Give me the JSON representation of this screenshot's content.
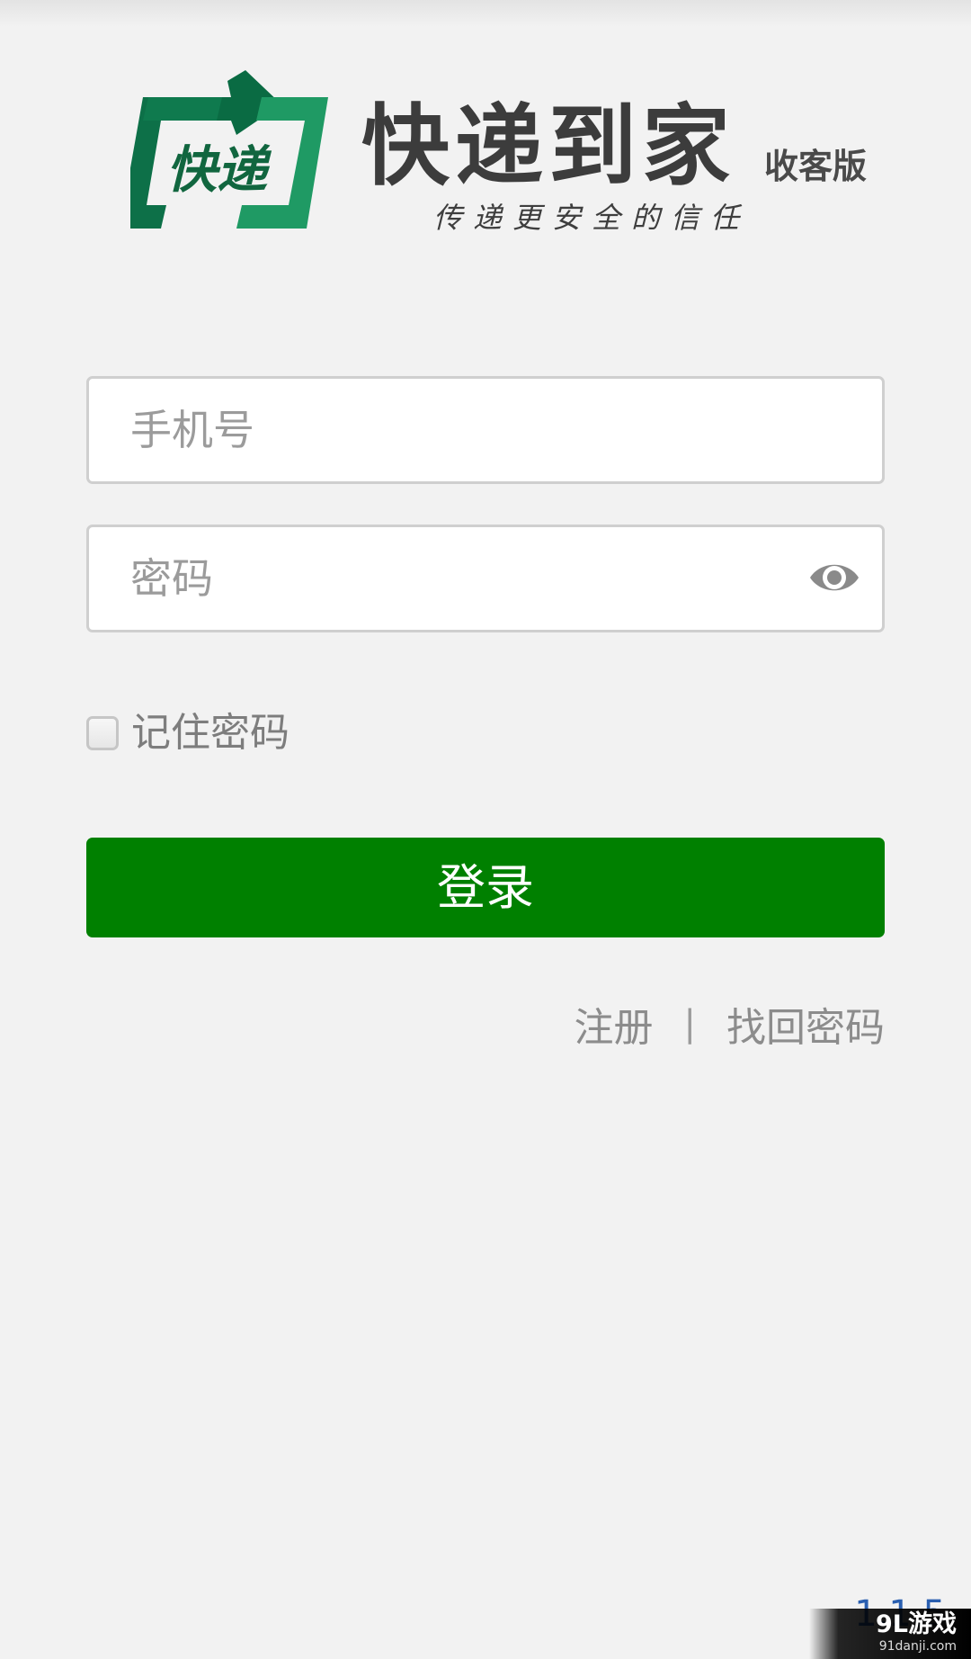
{
  "brand": {
    "logo_text": "快递",
    "title": "快递到家",
    "edition": "收客版",
    "slogan": "传递更安全的信任",
    "colors": {
      "logo_dark": "#0b6b45",
      "logo_light": "#1f9a64"
    }
  },
  "form": {
    "phone": {
      "placeholder": "手机号",
      "value": ""
    },
    "password": {
      "placeholder": "密码",
      "value": "",
      "toggle_icon": "eye-icon"
    },
    "remember": {
      "label": "记住密码",
      "checked": false
    },
    "login_label": "登录",
    "login_color": "#008000"
  },
  "links": {
    "register": "注册",
    "separator": "|",
    "recover": "找回密码"
  },
  "version": "1.1.5",
  "watermark": {
    "main": "9L游戏",
    "sub": "91danji.com"
  }
}
